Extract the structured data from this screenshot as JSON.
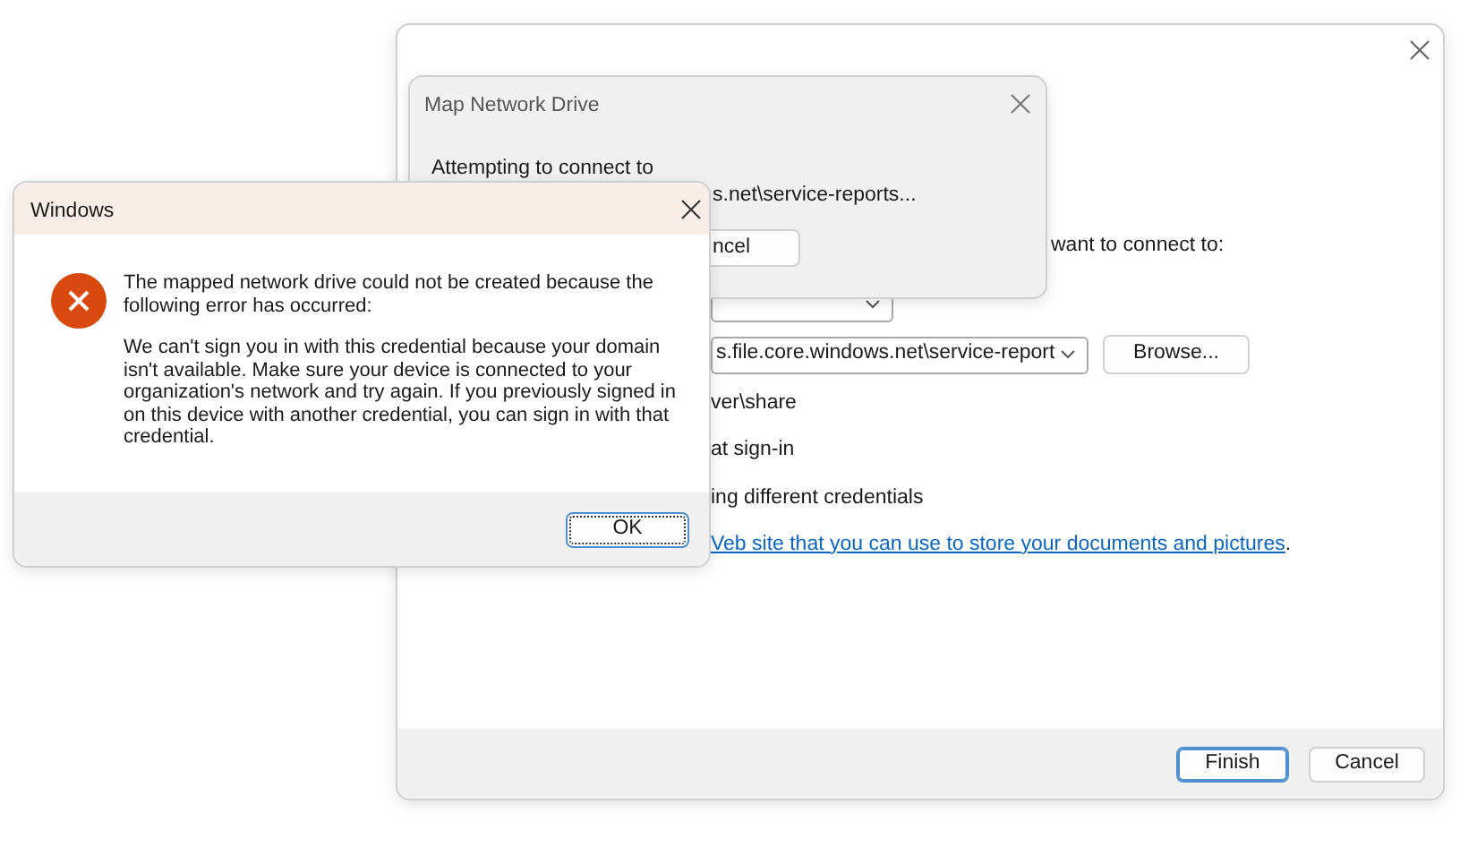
{
  "wizard": {
    "prompt_fragment": "want to connect to:",
    "folder_field": {
      "value": "s.file.core.windows.net\\service-report"
    },
    "browse_button": "Browse...",
    "option_fragments": [
      "ver\\share",
      "at sign-in",
      "ing different credentials"
    ],
    "link": "Veb site that you can use to store your documents and pictures",
    "link_end": ".",
    "buttons": [
      {
        "label": "Finish",
        "default": true
      },
      {
        "label": "Cancel",
        "default": false
      }
    ]
  },
  "progress": {
    "title": "Map Network Drive",
    "message": "Attempting to connect to",
    "path_fragment": "s.net\\service-reports...",
    "cancel_fragment": "ncel"
  },
  "error": {
    "title": "Windows",
    "message": "The mapped network drive could not be created because the following error has occurred:",
    "detail": "We can't sign you in with this credential because your domain isn't available. Make sure your device is connected to your organization's network and try again. If you previously signed in on this device with another credential, you can sign in with that credential.",
    "ok": {
      "label": "OK",
      "focused": true
    }
  }
}
